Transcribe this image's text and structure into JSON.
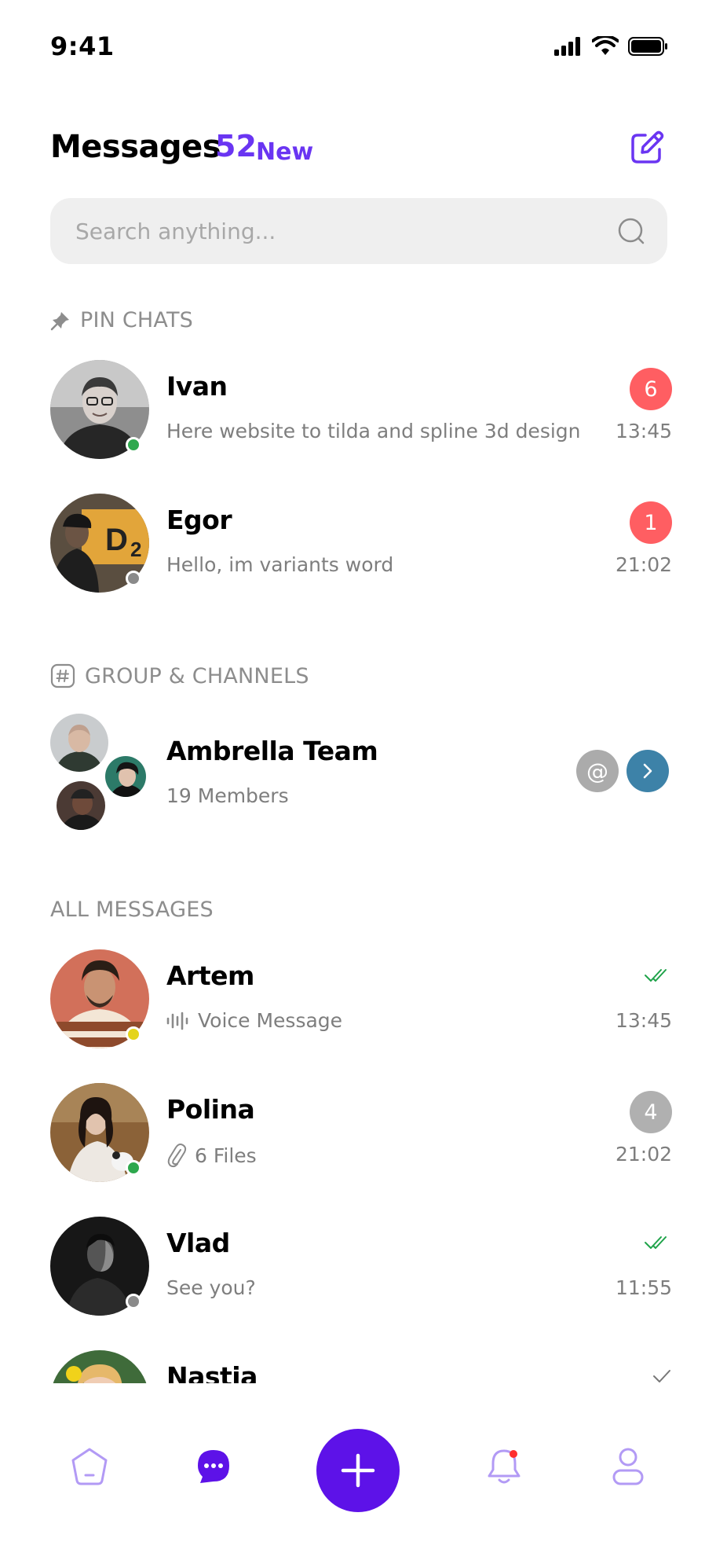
{
  "status_bar": {
    "time": "9:41"
  },
  "header": {
    "title": "Messages",
    "new_count": "52",
    "new_label": "New"
  },
  "search": {
    "placeholder": "Search anything..."
  },
  "sections": {
    "pinned": "PIN CHATS",
    "groups": "GROUP & CHANNELS",
    "all": "ALL MESSAGES"
  },
  "pinned": [
    {
      "name": "Ivan",
      "preview": "Here website to tilda and spline 3d design",
      "time": "13:45",
      "unread": "6"
    },
    {
      "name": "Egor",
      "preview": "Hello, im variants word",
      "time": "21:02",
      "unread": "1"
    }
  ],
  "group": {
    "name": "Ambrella Team",
    "members": "19 Members",
    "mention_symbol": "@"
  },
  "messages": [
    {
      "name": "Artem",
      "preview": "Voice Message",
      "time": "13:45"
    },
    {
      "name": "Polina",
      "preview": "6 Files",
      "time": "21:02",
      "unread": "4"
    },
    {
      "name": "Vlad",
      "preview": "See you?",
      "time": "11:55"
    },
    {
      "name": "Nastia"
    }
  ],
  "colors": {
    "accent": "#6A35F2",
    "fab": "#5D12E8",
    "unread_red": "#FF5E62",
    "unread_gray": "#B0B0B0",
    "online": "#2EA84D",
    "away": "#E4D41C",
    "offline": "#8A8A8A",
    "read_check": "#1FA34A",
    "group_arrow": "#3D82A8"
  },
  "icons": {
    "compose": "edit-icon",
    "search": "search-icon",
    "pin": "pin-icon",
    "hash": "hash-icon",
    "voice": "waveform-icon",
    "attach": "paperclip-icon",
    "nav": [
      "home-icon",
      "chat-icon",
      "plus-icon",
      "bell-icon",
      "profile-icon"
    ]
  }
}
